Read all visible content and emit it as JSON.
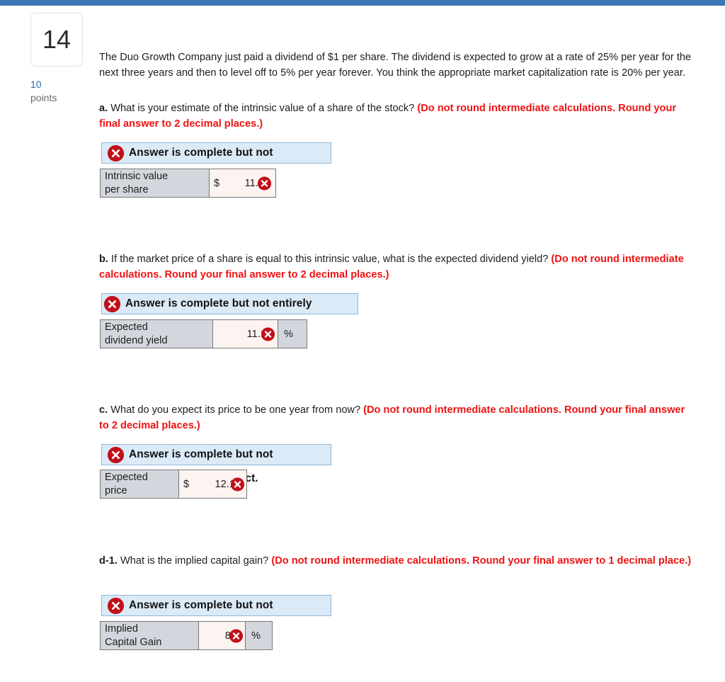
{
  "header": {
    "accent_color": "#3d78b5"
  },
  "gutter": {
    "question_number": "14",
    "points_value": "10",
    "points_label": "points"
  },
  "stem": {
    "text": "The Duo Growth Company just paid a dividend of $1 per share. The dividend is expected to grow at a rate of 25% per year for the next three years and then to level off to 5% per year forever. You think the appropriate market capitalization rate is 20% per year."
  },
  "colors": {
    "instruction_red": "#ef1212",
    "banner_bg": "#daeaf7",
    "banner_border": "#8fb8d8",
    "label_cell_bg": "#d3d7dd",
    "input_cell_bg": "#fdf4f2",
    "xmark_red": "#c2101a",
    "points_blue": "#2f6da8"
  },
  "parts": [
    {
      "id": "a",
      "label": "a.",
      "question": " What is your estimate of the intrinsic value of a share of the stock? ",
      "instruction": "(Do not round intermediate calculations. Round your final answer to 2 decimal places.)",
      "banner_text": "Answer is complete but not",
      "banner_icon": "error-circle-x-icon",
      "row": {
        "label_line1": "Intrinsic value",
        "label_line2": "per share",
        "prefix": "$",
        "value": "11.17",
        "unit": "",
        "bleed_text": ""
      }
    },
    {
      "id": "b",
      "label": "b.",
      "question": " If the market price of a share is equal to this intrinsic value, what is the expected dividend yield? ",
      "instruction": "(Do not round intermediate calculations. Round your final answer to 2 decimal places.)",
      "banner_text": "Answer is complete but not entirely",
      "banner_icon": "error-circle-x-icon",
      "row": {
        "label_line1": "Expected",
        "label_line2": "dividend yield",
        "prefix": "",
        "value": "11.19",
        "unit": "%",
        "bleed_text": ""
      }
    },
    {
      "id": "c",
      "label": "c.",
      "question": " What do you expect its price to be one year from now? ",
      "instruction": "(Do not round intermediate calculations. Round your final answer to 2 decimal places.)",
      "banner_text": "Answer is complete but not",
      "banner_icon": "error-circle-x-icon",
      "row": {
        "label_line1": "Expected",
        "label_line2": "price",
        "prefix": "$",
        "value": "12.15",
        "unit": "",
        "bleed_text": "rect."
      }
    },
    {
      "id": "d-1",
      "label": "d-1.",
      "question": " What is the implied capital gain? ",
      "instruction": "(Do not round intermediate calculations. Round your final answer to 1 decimal place.)",
      "banner_text": "Answer is complete but not",
      "banner_icon": "error-circle-x-icon",
      "row": {
        "label_line1": "Implied",
        "label_line2": "Capital Gain",
        "prefix": "",
        "value": "8.8",
        "unit": "%",
        "bleed_text": ""
      }
    }
  ]
}
